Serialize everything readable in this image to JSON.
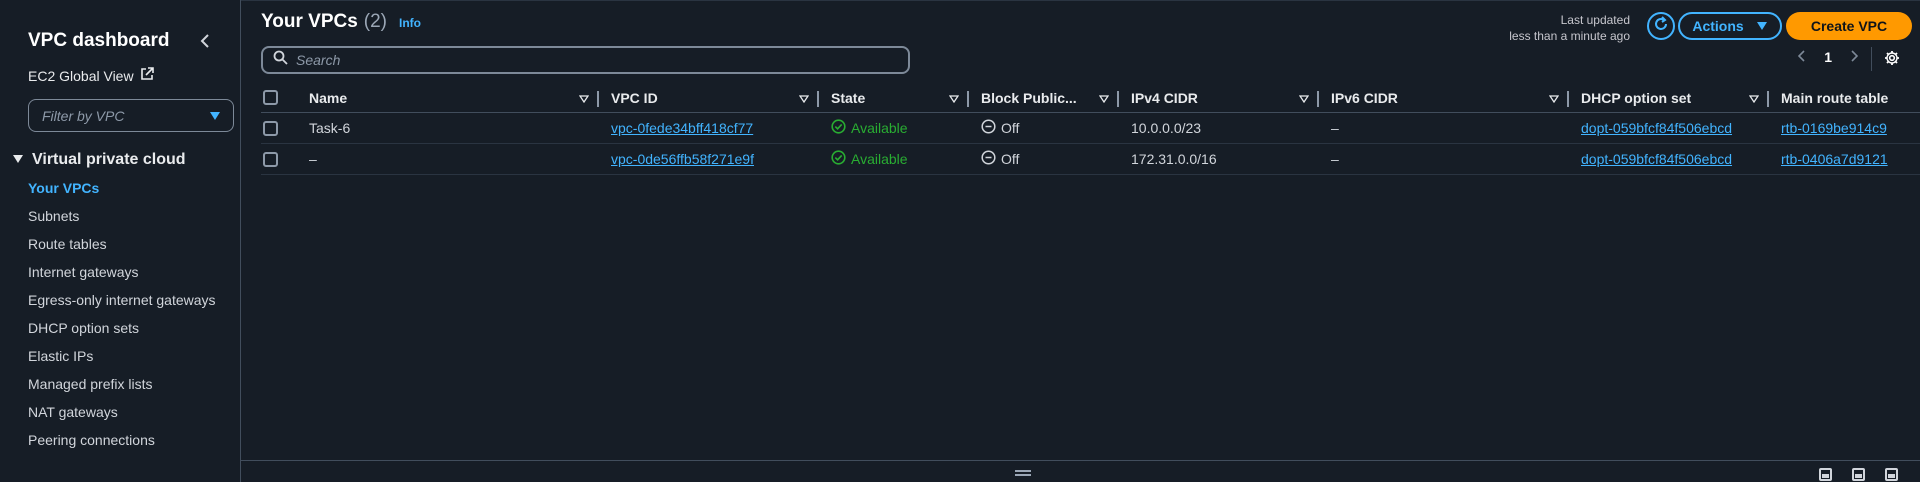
{
  "sidebar": {
    "title": "VPC dashboard",
    "global_view": "EC2 Global View",
    "filter_placeholder": "Filter by VPC",
    "section_title": "Virtual private cloud",
    "items": [
      {
        "label": "Your VPCs",
        "active": true
      },
      {
        "label": "Subnets"
      },
      {
        "label": "Route tables"
      },
      {
        "label": "Internet gateways"
      },
      {
        "label": "Egress-only internet gateways"
      },
      {
        "label": "DHCP option sets"
      },
      {
        "label": "Elastic IPs"
      },
      {
        "label": "Managed prefix lists"
      },
      {
        "label": "NAT gateways"
      },
      {
        "label": "Peering connections"
      }
    ]
  },
  "header": {
    "title": "Your VPCs",
    "count": "(2)",
    "info": "Info",
    "last_updated_label": "Last updated",
    "last_updated_value": "less than a minute ago",
    "actions_label": "Actions",
    "create_label": "Create VPC"
  },
  "search": {
    "placeholder": "Search"
  },
  "pagination": {
    "page": "1"
  },
  "table": {
    "columns": [
      "Name",
      "VPC ID",
      "State",
      "Block Public...",
      "IPv4 CIDR",
      "IPv6 CIDR",
      "DHCP option set",
      "Main route table"
    ],
    "rows": [
      {
        "name": "Task-6",
        "vpc_id": "vpc-0fede34bff418cf77",
        "state": "Available",
        "block_public": "Off",
        "ipv4": "10.0.0.0/23",
        "ipv6": "–",
        "dhcp": "dopt-059bfcf84f506ebcd",
        "route_table": "rtb-0169be914c9"
      },
      {
        "name": "–",
        "vpc_id": "vpc-0de56ffb58f271e9f",
        "state": "Available",
        "block_public": "Off",
        "ipv4": "172.31.0.0/16",
        "ipv6": "–",
        "dhcp": "dopt-059bfcf84f506ebcd",
        "route_table": "rtb-0406a7d9121"
      }
    ]
  },
  "colors": {
    "accent": "#42b4ff",
    "primary_button": "#ff9900",
    "status_available": "#29ad32",
    "background": "#161d26"
  }
}
